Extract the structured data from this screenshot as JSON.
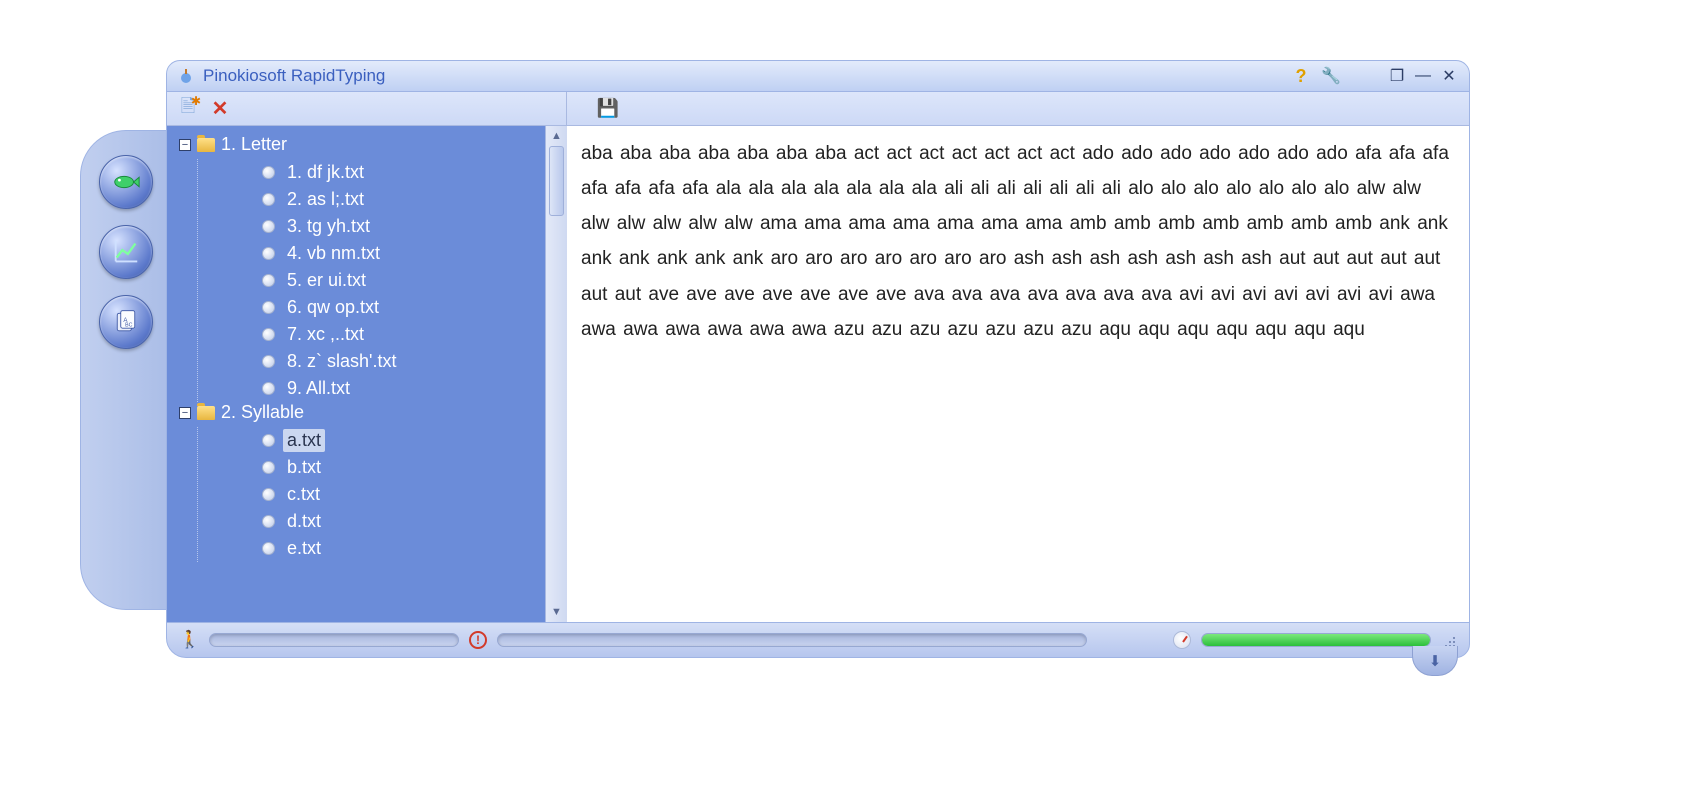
{
  "title": "Pinokiosoft RapidTyping",
  "tree": {
    "folders": [
      {
        "label": "1. Letter",
        "files": [
          {
            "label": "1. df jk.txt",
            "selected": false
          },
          {
            "label": "2. as l;.txt",
            "selected": false
          },
          {
            "label": "3. tg yh.txt",
            "selected": false
          },
          {
            "label": "4. vb nm.txt",
            "selected": false
          },
          {
            "label": "5. er ui.txt",
            "selected": false
          },
          {
            "label": "6. qw op.txt",
            "selected": false
          },
          {
            "label": "7. xc ,..txt",
            "selected": false
          },
          {
            "label": "8. z` slash'.txt",
            "selected": false
          },
          {
            "label": "9. All.txt",
            "selected": false
          }
        ]
      },
      {
        "label": "2. Syllable",
        "files": [
          {
            "label": "a.txt",
            "selected": true
          },
          {
            "label": "b.txt",
            "selected": false
          },
          {
            "label": "c.txt",
            "selected": false
          },
          {
            "label": "d.txt",
            "selected": false
          },
          {
            "label": "e.txt",
            "selected": false
          }
        ]
      }
    ]
  },
  "content_text": "aba aba aba aba aba aba aba act act act act act act act ado ado ado ado ado ado ado afa afa afa afa afa afa afa ala ala ala ala ala ala ala ali ali ali ali ali ali ali alo alo alo alo alo alo alo alw alw alw alw alw alw alw ama ama ama ama ama ama ama amb amb amb amb amb amb amb ank ank ank ank ank ank ank aro aro aro aro aro aro aro ash ash ash ash ash ash ash aut aut aut aut aut aut aut ave ave ave ave ave ave ave ava ava ava ava ava ava ava avi avi avi avi avi avi avi awa awa awa awa awa awa awa azu azu azu azu azu azu azu aqu aqu aqu aqu aqu aqu aqu",
  "icons": {
    "help": "?",
    "wrench": "🔧",
    "restore": "❐",
    "minimize": "—",
    "close": "✕",
    "newdoc": "🗎",
    "deletedoc": "✕",
    "save": "💾",
    "person": "🚶",
    "exclaim": "!",
    "arrow_down": "⬇"
  }
}
